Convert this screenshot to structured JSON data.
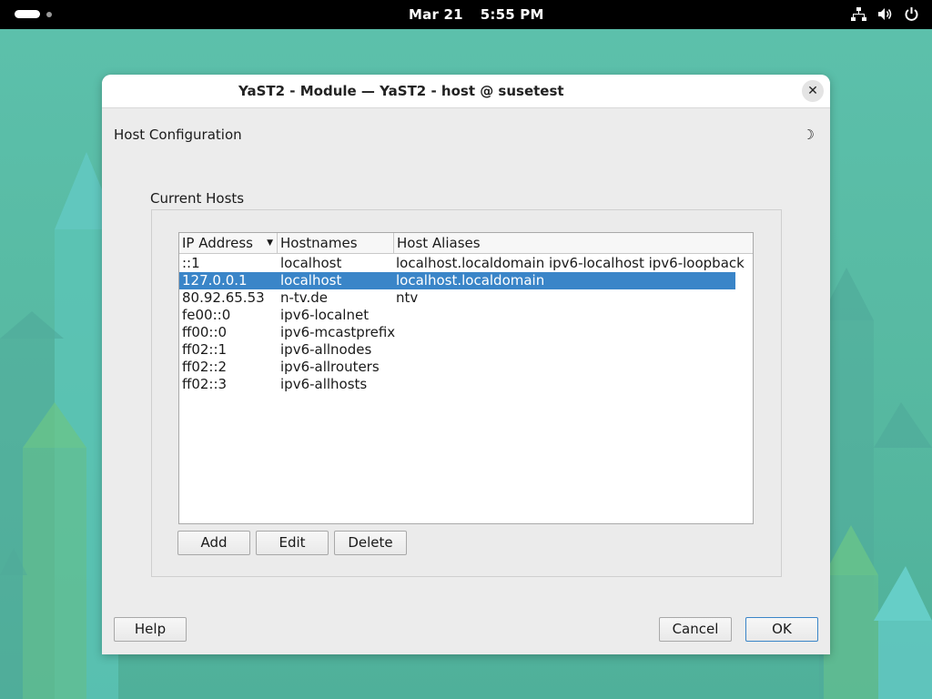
{
  "topbar": {
    "date": "Mar 21",
    "time": "5:55 PM",
    "icons": [
      "network-icon",
      "volume-icon",
      "power-icon"
    ]
  },
  "window": {
    "title": "YaST2 - Module — YaST2 - host @ susetest",
    "close_symbol": "✕",
    "heading": "Host Configuration",
    "moon_symbol": "☽"
  },
  "hosts": {
    "group_label": "Current Hosts",
    "columns": [
      "IP Address",
      "Hostnames",
      "Host Aliases"
    ],
    "rows": [
      {
        "ip": "::1",
        "hostname": "localhost",
        "aliases": "localhost.localdomain ipv6-localhost ipv6-loopback",
        "selected": false
      },
      {
        "ip": "127.0.0.1",
        "hostname": "localhost",
        "aliases": "localhost.localdomain",
        "selected": true
      },
      {
        "ip": "80.92.65.53",
        "hostname": "n-tv.de",
        "aliases": "ntv",
        "selected": false
      },
      {
        "ip": "fe00::0",
        "hostname": "ipv6-localnet",
        "aliases": "",
        "selected": false
      },
      {
        "ip": "ff00::0",
        "hostname": "ipv6-mcastprefix",
        "aliases": "",
        "selected": false
      },
      {
        "ip": "ff02::1",
        "hostname": "ipv6-allnodes",
        "aliases": "",
        "selected": false
      },
      {
        "ip": "ff02::2",
        "hostname": "ipv6-allrouters",
        "aliases": "",
        "selected": false
      },
      {
        "ip": "ff02::3",
        "hostname": "ipv6-allhosts",
        "aliases": "",
        "selected": false
      }
    ],
    "buttons": {
      "add": "Add",
      "edit": "Edit",
      "delete": "Delete"
    }
  },
  "footer": {
    "help": "Help",
    "cancel": "Cancel",
    "ok": "OK"
  },
  "colors": {
    "selection": "#3a85c8",
    "topbar": "#000000",
    "desktop": "#5cc0ab"
  }
}
